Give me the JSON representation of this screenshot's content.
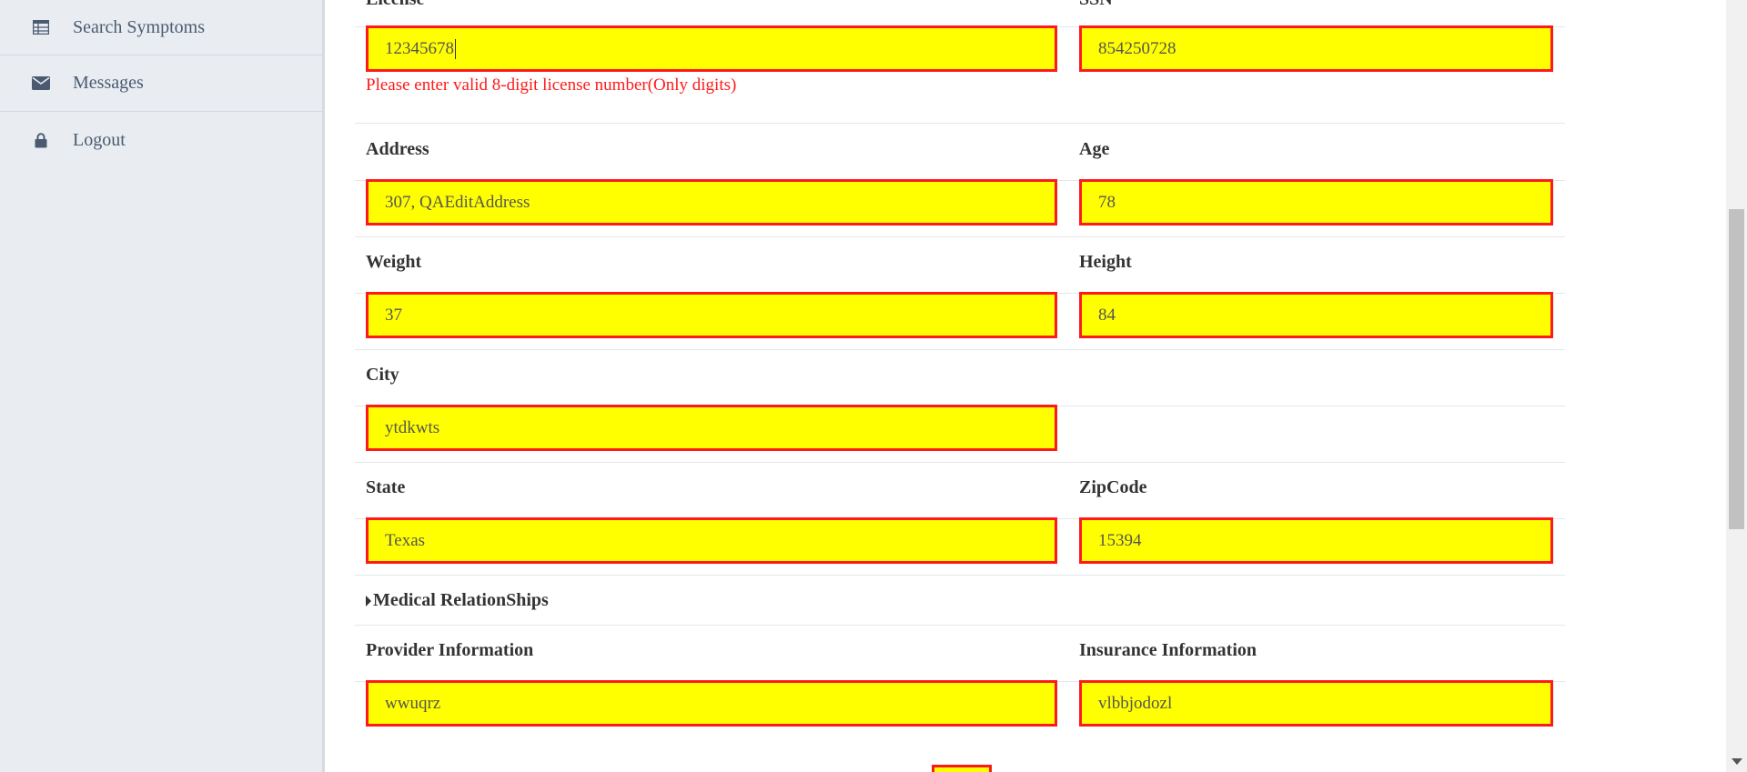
{
  "sidebar": {
    "items": [
      {
        "label": "Search Symptoms",
        "icon": "table-icon"
      },
      {
        "label": "Messages",
        "icon": "envelope-icon"
      },
      {
        "label": "Logout",
        "icon": "lock-icon"
      }
    ]
  },
  "form": {
    "license": {
      "label": "License",
      "value": "12345678",
      "error": "Please enter valid 8-digit license number(Only digits)"
    },
    "ssn": {
      "label": "SSN",
      "value": "854250728"
    },
    "address": {
      "label": "Address",
      "value": "307, QAEditAddress"
    },
    "age": {
      "label": "Age",
      "value": "78"
    },
    "weight": {
      "label": "Weight",
      "value": "37"
    },
    "height": {
      "label": "Height",
      "value": "84"
    },
    "city": {
      "label": "City",
      "value": "ytdkwts"
    },
    "state": {
      "label": "State",
      "value": "Texas"
    },
    "zipcode": {
      "label": "ZipCode",
      "value": "15394"
    },
    "medical_relationships": {
      "label": "Medical RelationShips"
    },
    "provider_information": {
      "label": "Provider Information",
      "value": "wwuqrz"
    },
    "insurance_information": {
      "label": "Insurance Information",
      "value": "vlbbjodozl"
    }
  },
  "colors": {
    "field_fill": "#ffff00",
    "field_border": "#ff1a1a",
    "error_text": "#ff1a1a",
    "sidebar_bg": "#e9edf2"
  }
}
